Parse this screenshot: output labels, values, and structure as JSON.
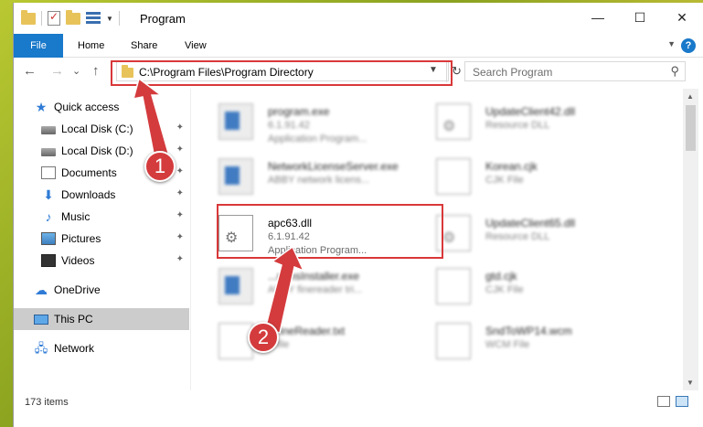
{
  "window": {
    "title": "Program",
    "controls": {
      "minimize": "—",
      "maximize": "☐",
      "close": "✕"
    }
  },
  "ribbon": {
    "tabs": [
      {
        "label": "File"
      },
      {
        "label": "Home"
      },
      {
        "label": "Share"
      },
      {
        "label": "View"
      }
    ],
    "help": "?"
  },
  "navigation": {
    "back": "←",
    "forward": "→",
    "recent": "⌄",
    "up": "↑",
    "address": "C:\\Program Files\\Program Directory",
    "refresh": "↻",
    "search_placeholder": "Search Program",
    "search_icon": "⚲"
  },
  "sidebar": {
    "items": [
      {
        "label": "Quick access",
        "icon": "star-icon",
        "pinned": false
      },
      {
        "label": "Local Disk (C:)",
        "icon": "disk-icon",
        "pinned": true
      },
      {
        "label": "Local Disk (D:)",
        "icon": "disk-icon",
        "pinned": true
      },
      {
        "label": "Documents",
        "icon": "document-icon",
        "pinned": true
      },
      {
        "label": "Downloads",
        "icon": "download-icon",
        "pinned": true
      },
      {
        "label": "Music",
        "icon": "music-icon",
        "pinned": true
      },
      {
        "label": "Pictures",
        "icon": "pictures-icon",
        "pinned": true
      },
      {
        "label": "Videos",
        "icon": "video-icon",
        "pinned": true
      },
      {
        "label": "OneDrive",
        "icon": "cloud-icon",
        "pinned": false
      },
      {
        "label": "This PC",
        "icon": "computer-icon",
        "pinned": false,
        "selected": true
      },
      {
        "label": "Network",
        "icon": "network-icon",
        "pinned": false
      }
    ],
    "pin_glyph": "📌"
  },
  "files": [
    {
      "name": "program.exe",
      "line2": "6.1.91.42",
      "line3": "Application Program...",
      "icon": "app-icon",
      "blurred": true
    },
    {
      "name": "UpdateClient42.dll",
      "line2": "Resource DLL",
      "line3": "",
      "icon": "dll-icon",
      "blurred": true
    },
    {
      "name": "NetworkLicenseServer.exe",
      "line2": "ABBY network licens...",
      "line3": "",
      "icon": "app-icon",
      "blurred": true
    },
    {
      "name": "Korean.cjk",
      "line2": "CJK File",
      "line3": "",
      "icon": "file-icon",
      "blurred": true
    },
    {
      "name": "apc63.dll",
      "line2": "6.1.91.42",
      "line3": "Application Program...",
      "icon": "dll-icon",
      "blurred": false
    },
    {
      "name": "UpdateClient65.dll",
      "line2": "Resource DLL",
      "line3": "",
      "icon": "dll-icon",
      "blurred": true
    },
    {
      "name": "...mmsInstaller.exe",
      "line2": "ABBY finereader tri...",
      "line3": "",
      "icon": "app-icon",
      "blurred": true
    },
    {
      "name": "gtd.cjk",
      "line2": "CJK File",
      "line3": "",
      "icon": "file-icon",
      "blurred": true
    },
    {
      "name": "...fineReader.txt",
      "line2": "...file",
      "line3": "",
      "icon": "file-icon",
      "blurred": true
    },
    {
      "name": "SndToWP14.wcm",
      "line2": "WCM File",
      "line3": "",
      "icon": "file-icon",
      "blurred": true
    }
  ],
  "status": {
    "item_count": "173 items"
  },
  "annotations": [
    {
      "label": "1"
    },
    {
      "label": "2"
    }
  ],
  "colors": {
    "accent": "#1979ca",
    "annotation_red": "#d43b3d",
    "selection_gray": "#cccccc"
  }
}
